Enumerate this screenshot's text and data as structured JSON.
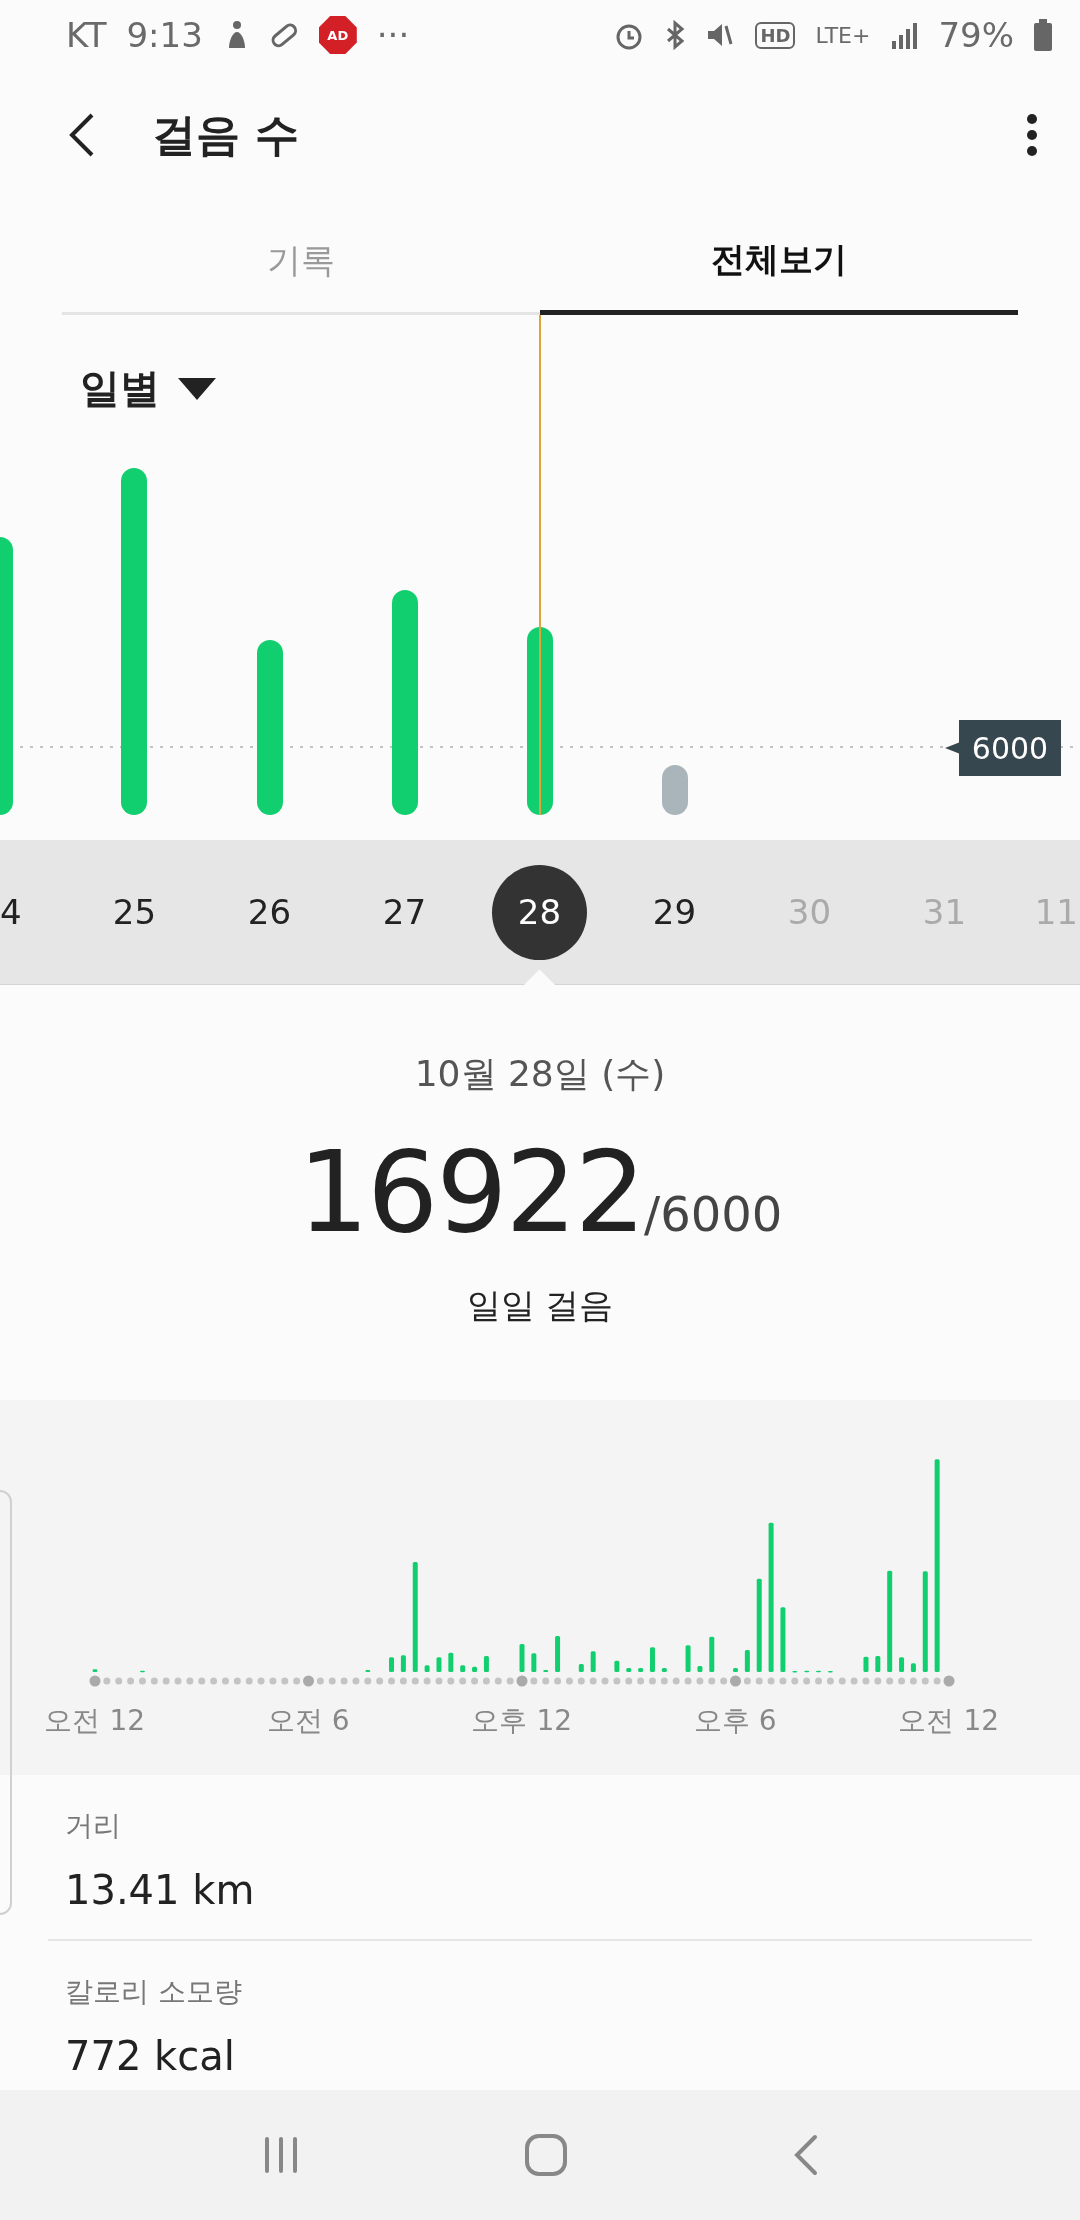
{
  "status_bar": {
    "carrier": "KT",
    "time": "9:13",
    "ad_badge": "AD",
    "more": "···",
    "hd": "HD",
    "network": "LTE+",
    "battery": "79%"
  },
  "header": {
    "title": "걸음 수"
  },
  "tabs": [
    {
      "label": "기록",
      "selected": false
    },
    {
      "label": "전체보기",
      "selected": true
    }
  ],
  "period_dropdown": {
    "label": "일별"
  },
  "goal_label": "6000",
  "days": [
    {
      "label": "4",
      "selected": false,
      "future": false
    },
    {
      "label": "25",
      "selected": false,
      "future": false
    },
    {
      "label": "26",
      "selected": false,
      "future": false
    },
    {
      "label": "27",
      "selected": false,
      "future": false
    },
    {
      "label": "28",
      "selected": true,
      "future": false
    },
    {
      "label": "29",
      "selected": false,
      "future": false
    },
    {
      "label": "30",
      "selected": false,
      "future": true
    },
    {
      "label": "31",
      "selected": false,
      "future": true
    },
    {
      "label": "11",
      "selected": false,
      "future": true
    }
  ],
  "summary": {
    "date": "10월 28일 (수)",
    "steps": "16922",
    "goal": "/6000",
    "caption": "일일 걸음"
  },
  "hourly_axis": [
    "오전 12",
    "오전 6",
    "오후 12",
    "오후 6",
    "오전 12"
  ],
  "stats": [
    {
      "label": "거리",
      "value": "13.41 km"
    },
    {
      "label": "칼로리 소모량",
      "value": "772 kcal"
    }
  ]
}
